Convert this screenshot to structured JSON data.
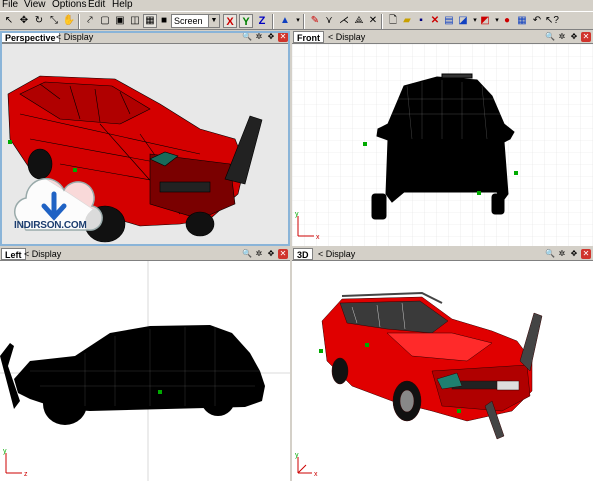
{
  "menu": {
    "file": "File",
    "view": "View",
    "options": "Options",
    "edit": "Edit",
    "help": "Help"
  },
  "toolbar": {
    "space_value": "Screen",
    "axis_x": "X",
    "axis_y": "Y",
    "axis_z": "Z"
  },
  "viewports": {
    "perspective": {
      "title": "Perspective",
      "display": "< Display"
    },
    "front": {
      "title": "Front",
      "display": "< Display"
    },
    "left": {
      "title": "Left",
      "display": "< Display"
    },
    "threed": {
      "title": "3D",
      "display": "< Display"
    }
  },
  "watermark": {
    "text": "INDIRSON.COM"
  },
  "colors": {
    "chrome": "#d4d0c8",
    "car_body": "#d40000",
    "wireframe": "#000000",
    "grid": "#e4e4e4",
    "selection": "#8ab4d8"
  }
}
